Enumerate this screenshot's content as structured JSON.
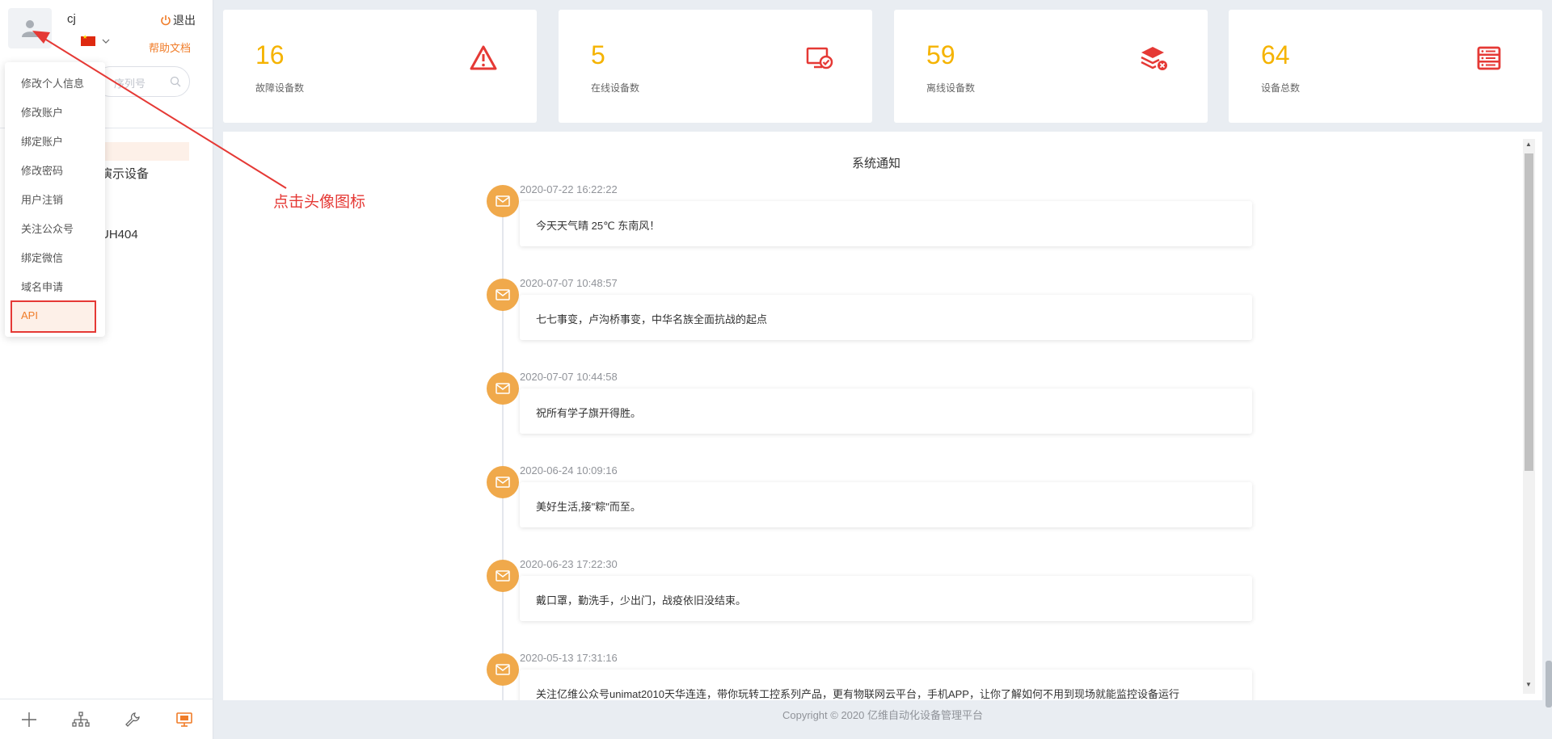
{
  "user": {
    "name": "cj",
    "logout_label": "退出",
    "help_label": "帮助文档"
  },
  "search": {
    "placeholder": "序列号"
  },
  "tree": {
    "item1": "演示设备",
    "item2": "UH404"
  },
  "dropdown": {
    "items": [
      "修改个人信息",
      "修改账户",
      "绑定账户",
      "修改密码",
      "用户注销",
      "关注公众号",
      "绑定微信",
      "域名申请",
      "API"
    ]
  },
  "stats": [
    {
      "value": "16",
      "label": "故障设备数",
      "icon": "warning-triangle-icon"
    },
    {
      "value": "5",
      "label": "在线设备数",
      "icon": "monitor-check-icon"
    },
    {
      "value": "59",
      "label": "离线设备数",
      "icon": "stack-offline-icon"
    },
    {
      "value": "64",
      "label": "设备总数",
      "icon": "server-list-icon"
    }
  ],
  "notices": {
    "title": "系统通知",
    "items": [
      {
        "date": "2020-07-22 16:22:22",
        "text": "今天天气晴 25℃ 东南风！"
      },
      {
        "date": "2020-07-07 10:48:57",
        "text": "七七事变，卢沟桥事变，中华名族全面抗战的起点"
      },
      {
        "date": "2020-07-07 10:44:58",
        "text": "祝所有学子旗开得胜。"
      },
      {
        "date": "2020-06-24 10:09:16",
        "text": "美好生活,接\"粽\"而至。"
      },
      {
        "date": "2020-06-23 17:22:30",
        "text": "戴口罩，勤洗手，少出门，战疫依旧没结束。"
      },
      {
        "date": "2020-05-13 17:31:16",
        "text": "关注亿维公众号unimat2010天华连连，带你玩转工控系列产品，更有物联网云平台，手机APP，让你了解如何不用到现场就能监控设备运行"
      }
    ]
  },
  "footer": {
    "text": "Copyright © 2020 亿维自动化设备管理平台"
  },
  "annotation": {
    "text": "点击头像图标"
  },
  "colors": {
    "accent": "#f07c28",
    "stat_number": "#f5b300",
    "icon_red": "#e53935",
    "timeline_dot": "#f0a94b"
  }
}
